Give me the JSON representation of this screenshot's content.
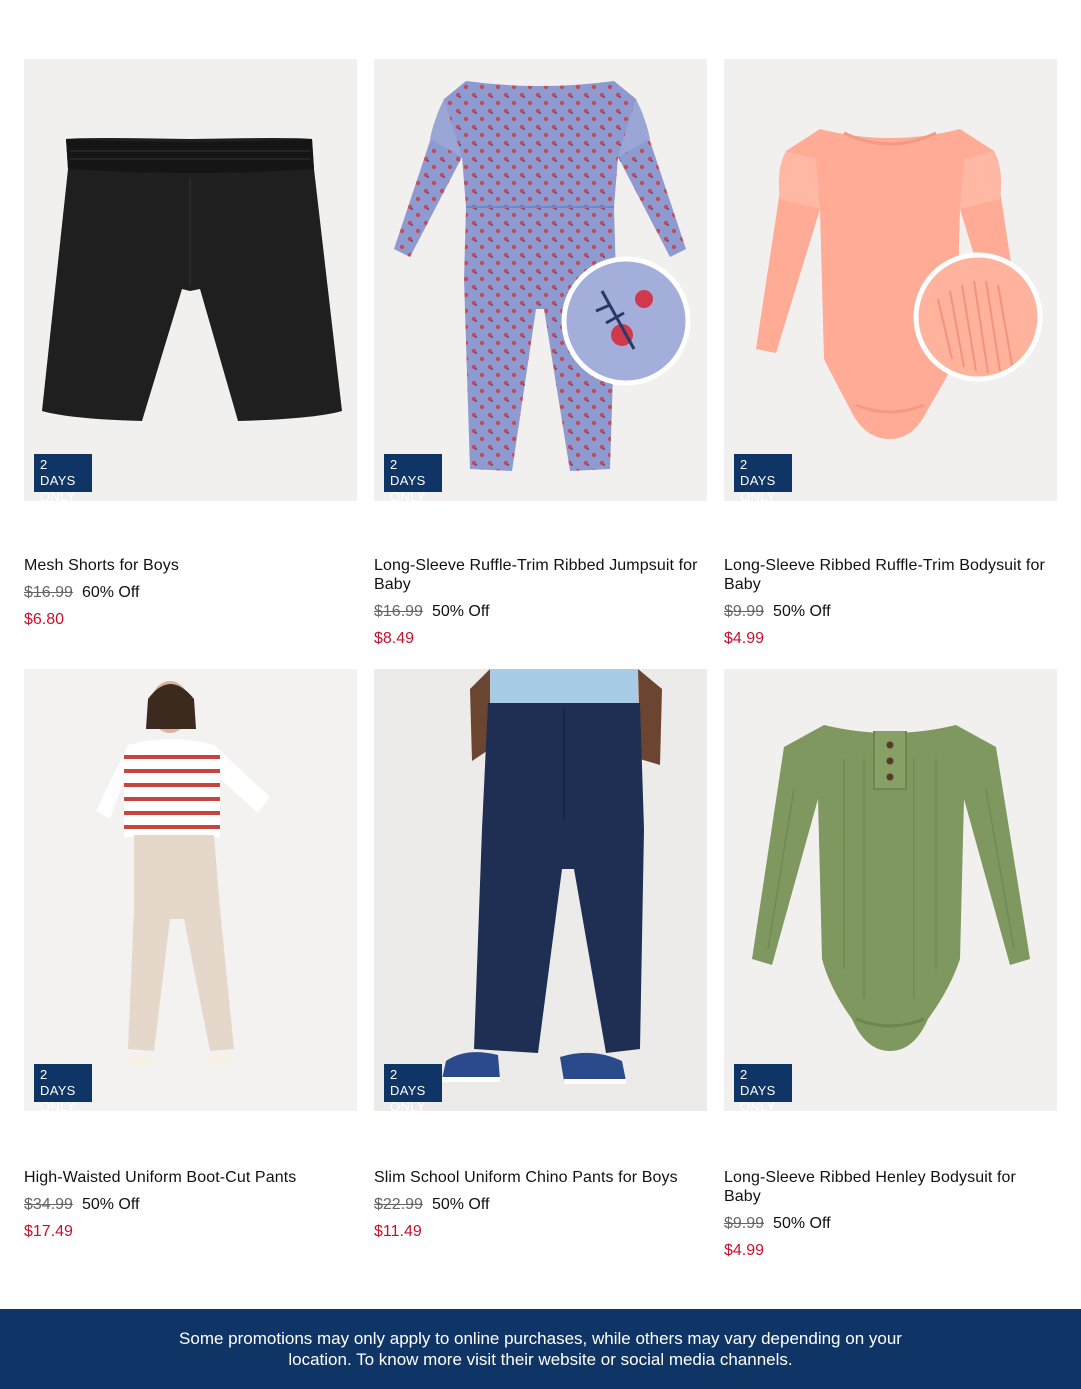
{
  "products": [
    {
      "badge_line1": "2 DAYS",
      "badge_line2": "ONLY",
      "title": "Mesh Shorts for Boys",
      "was_price": "$16.99",
      "discount": "60% Off",
      "sale_price": "$6.80",
      "image": "black-shorts"
    },
    {
      "badge_line1": "2 DAYS",
      "badge_line2": "ONLY",
      "title": "Long-Sleeve Ruffle-Trim Ribbed Jumpsuit for Baby",
      "was_price": "$16.99",
      "discount": "50% Off",
      "sale_price": "$8.49",
      "image": "floral-jumpsuit"
    },
    {
      "badge_line1": "2 DAYS",
      "badge_line2": "ONLY",
      "title": "Long-Sleeve Ribbed Ruffle-Trim Bodysuit for Baby",
      "was_price": "$9.99",
      "discount": "50% Off",
      "sale_price": "$4.99",
      "image": "peach-bodysuit"
    },
    {
      "badge_line1": "2 DAYS",
      "badge_line2": "ONLY",
      "title": "High-Waisted Uniform Boot-Cut Pants",
      "was_price": "$34.99",
      "discount": "50% Off",
      "sale_price": "$17.49",
      "image": "model-beige-pants"
    },
    {
      "badge_line1": "2 DAYS",
      "badge_line2": "ONLY",
      "title": "Slim School Uniform Chino Pants for Boys",
      "was_price": "$22.99",
      "discount": "50% Off",
      "sale_price": "$11.49",
      "image": "navy-chino-pants"
    },
    {
      "badge_line1": "2 DAYS",
      "badge_line2": "ONLY",
      "title": "Long-Sleeve Ribbed Henley Bodysuit for Baby",
      "was_price": "$9.99",
      "discount": "50% Off",
      "sale_price": "$4.99",
      "image": "green-henley-bodysuit"
    }
  ],
  "footer": {
    "text": "Some promotions may only apply to online purchases, while others may vary depending on your location. To know more visit their website or social media channels."
  },
  "colors": {
    "badge_bg": "#0f3566",
    "sale_red": "#c8102e",
    "footer_bg": "#0f3566",
    "image_bg": "#f1f0ee"
  }
}
